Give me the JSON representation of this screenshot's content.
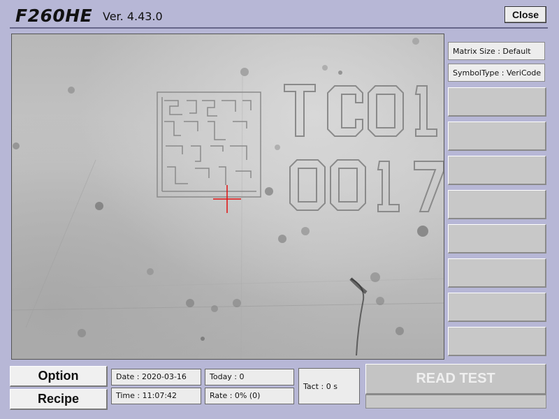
{
  "header": {
    "app_name": "F260HE",
    "version": "Ver. 4.43.0",
    "close_label": "Close"
  },
  "side_panel": {
    "matrix_size": "Matrix Size : Default",
    "symbol_type": "SymbolType : VeriCode"
  },
  "buttons": {
    "option": "Option",
    "recipe": "Recipe",
    "read_test": "READ TEST"
  },
  "stats": {
    "date": "Date : 2020-03-16",
    "time": "Time : 11:07:42",
    "today": "Today : 0",
    "rate": "Rate : 0% (0)",
    "tact": "Tact : 0 s"
  },
  "camera_view": {
    "marking_line1": "TC01",
    "marking_line2": "0017",
    "crosshair_color": "#e01010"
  },
  "colors": {
    "background": "#b7b7d6",
    "read_test_text": "#efefef"
  }
}
